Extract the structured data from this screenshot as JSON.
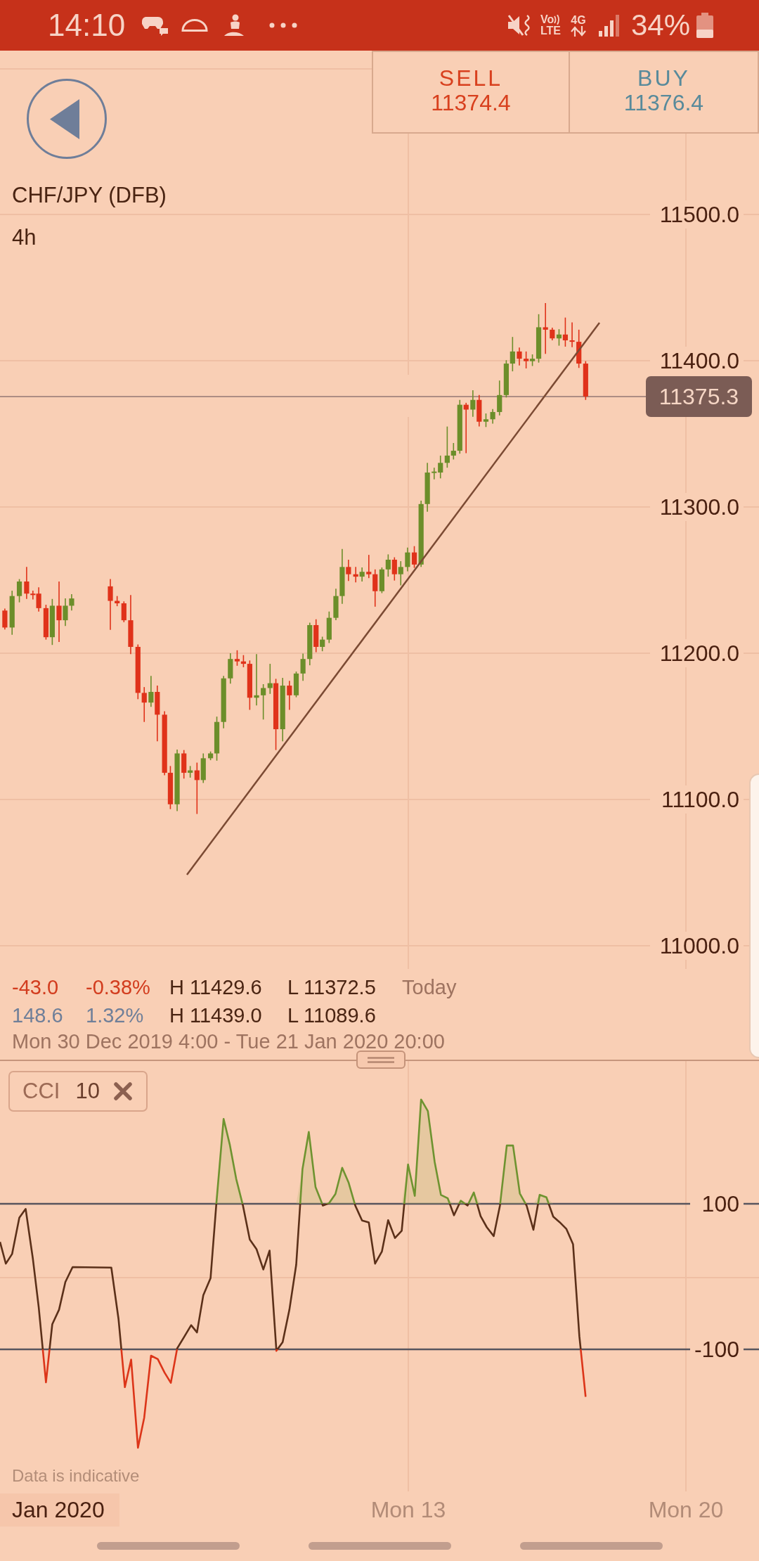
{
  "status_bar": {
    "time": "14:10",
    "volte": [
      "Vo",
      "LTE"
    ],
    "network_type": "4G",
    "battery": "34%"
  },
  "quote_buttons": [
    {
      "kind": "sell",
      "label": "SELL",
      "price": "11374.4"
    },
    {
      "kind": "buy",
      "label": "BUY",
      "price": "11376.4"
    }
  ],
  "instrument": {
    "name": "CHF/JPY (DFB)",
    "timeframe": "4h"
  },
  "price_chart": {
    "y_axis_labels": [
      "11500.0",
      "11400.0",
      "11300.0",
      "11200.0",
      "11100.0",
      "11000.0"
    ],
    "current_price": "11375.3"
  },
  "stats": [
    {
      "color": "#d23c1e",
      "change": "-43.0",
      "percent": "-0.38%",
      "high": "H 11429.6",
      "low": "L 11372.5",
      "period": "Today"
    },
    {
      "color": "#6f7f99",
      "change": "148.6",
      "percent": "1.32%",
      "high": "H 11439.0",
      "low": "L 11089.6"
    }
  ],
  "date_range": "Mon 30 Dec 2019 4:00 - Tue 21 Jan 2020 20:00",
  "indicator": {
    "name": "CCI",
    "period": "10",
    "levels": [
      "100",
      "-100"
    ]
  },
  "disclaimer": "Data is indicative",
  "x_axis_labels": [
    {
      "kind": "month",
      "label": "Jan 2020"
    },
    {
      "kind": "day",
      "label": "Mon 13"
    },
    {
      "kind": "day",
      "label": "Mon 20"
    }
  ]
}
